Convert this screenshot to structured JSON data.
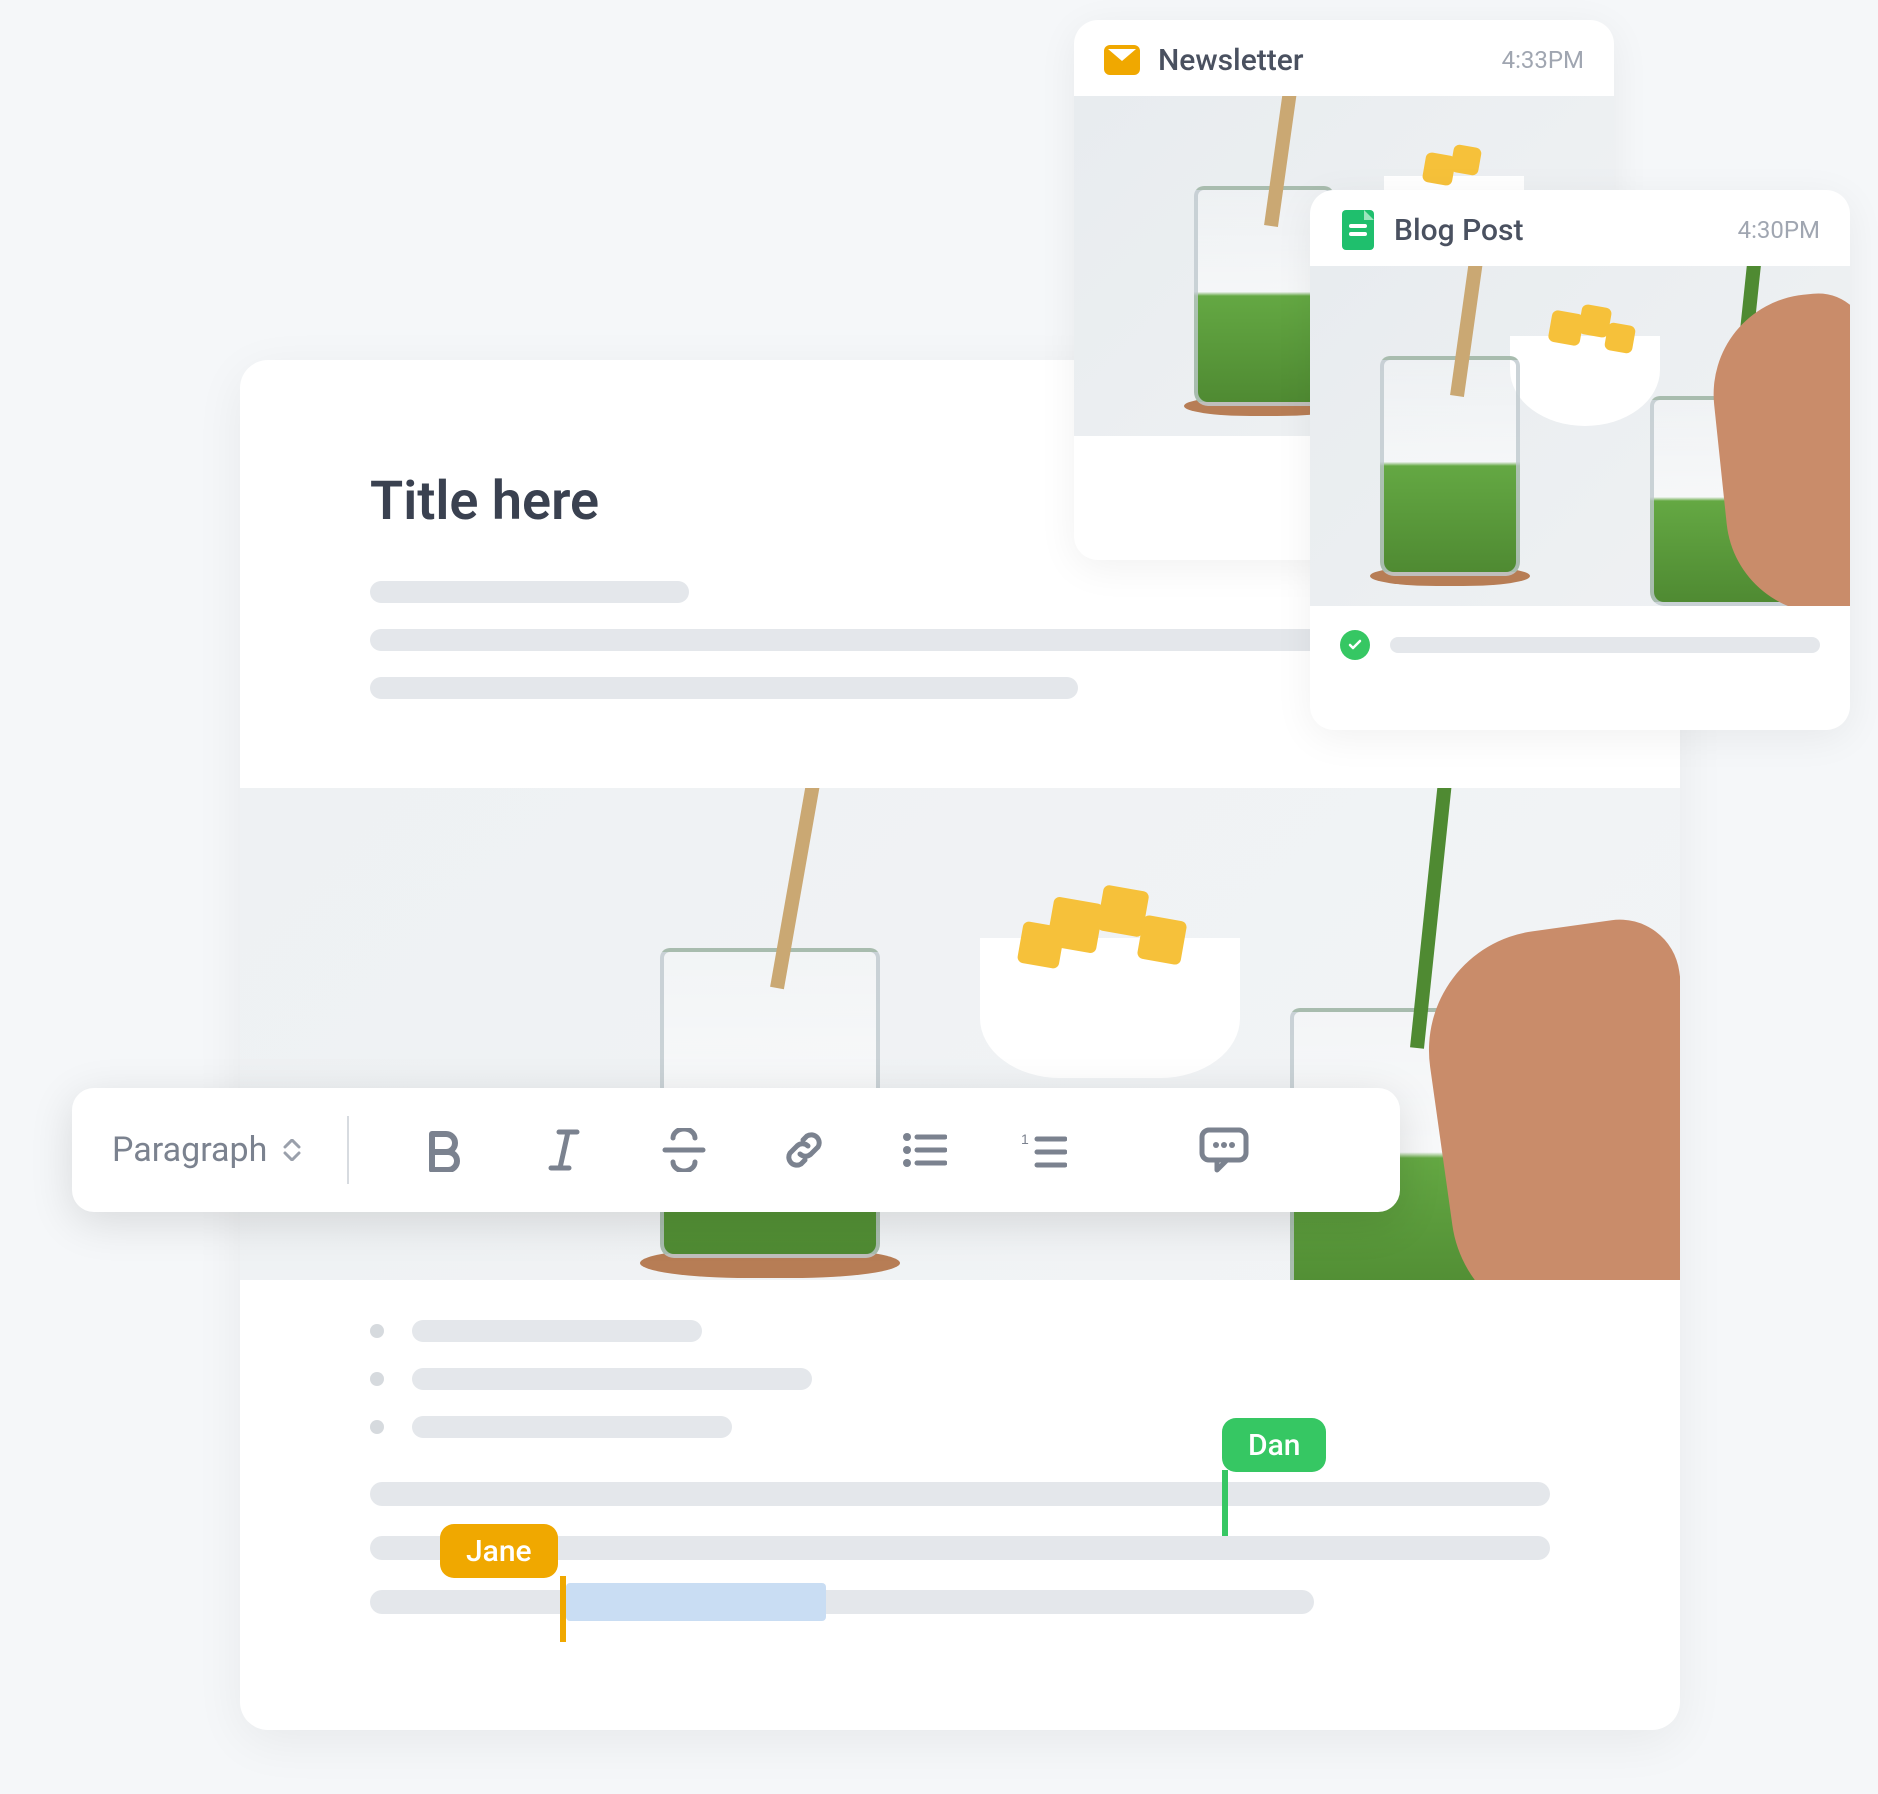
{
  "cards": {
    "newsletter": {
      "title": "Newsletter",
      "time": "4:33PM",
      "icon": "envelope-icon"
    },
    "blogpost": {
      "title": "Blog Post",
      "time": "4:30PM",
      "icon": "document-icon",
      "status_icon": "check-icon"
    }
  },
  "editor": {
    "title_placeholder": "Title here"
  },
  "toolbar": {
    "style_label": "Paragraph",
    "buttons": {
      "bold": "B",
      "italic": "I",
      "strike": "S",
      "link": "link-icon",
      "ul": "bullet-list-icon",
      "ol": "numbered-list-icon",
      "comment": "comment-icon"
    }
  },
  "collaborators": {
    "dan": {
      "name": "Dan",
      "color": "#36c763"
    },
    "jane": {
      "name": "Jane",
      "color": "#f0a800"
    }
  }
}
